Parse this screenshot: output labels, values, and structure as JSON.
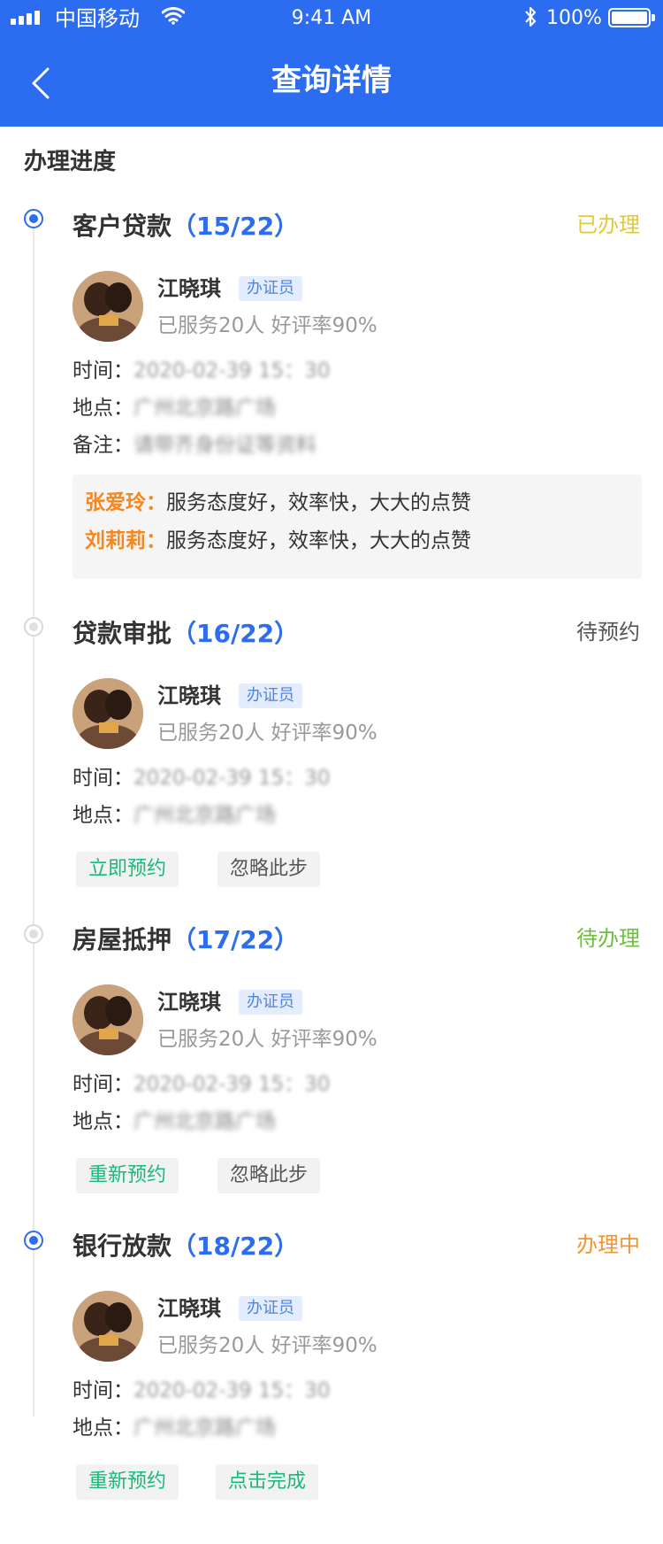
{
  "status_bar": {
    "carrier": "中国移动",
    "time": "9:41 AM",
    "battery": "100%"
  },
  "nav": {
    "title": "查询详情"
  },
  "section_title": "办理进度",
  "colors": {
    "primary": "#2b6cf0",
    "status_done": "#e2c93a",
    "status_pending": "#555555",
    "status_todo": "#6cbf3c",
    "status_in_progress": "#f5932f",
    "button_green": "#19b97b",
    "comment_name": "#f5871f"
  },
  "steps": [
    {
      "title": "客户贷款",
      "progress": "（15/22）",
      "status": "已办理",
      "agent": {
        "name": "江晓琪",
        "role": "办证员",
        "stats": "已服务20人   好评率90%"
      },
      "time_label": "时间：",
      "time_value": "2020-02-39 15：30",
      "location_label": "地点：",
      "location_value": "广州北京路广场",
      "note_label": "备注：",
      "note_value": "请带齐身份证等资料",
      "comments": [
        {
          "name": "张爱玲：",
          "text": "服务态度好，效率快，大大的点赞"
        },
        {
          "name": "刘莉莉：",
          "text": "服务态度好，效率快，大大的点赞"
        }
      ]
    },
    {
      "title": "贷款审批",
      "progress": "（16/22）",
      "status": "待预约",
      "agent": {
        "name": "江晓琪",
        "role": "办证员",
        "stats": "已服务20人   好评率90%"
      },
      "time_label": "时间：",
      "time_value": "2020-02-39 15：30",
      "location_label": "地点：",
      "location_value": "广州北京路广场",
      "buttons": [
        "立即预约",
        "忽略此步"
      ]
    },
    {
      "title": "房屋抵押",
      "progress": "（17/22）",
      "status": "待办理",
      "agent": {
        "name": "江晓琪",
        "role": "办证员",
        "stats": "已服务20人   好评率90%"
      },
      "time_label": "时间：",
      "time_value": "2020-02-39 15：30",
      "location_label": "地点：",
      "location_value": "广州北京路广场",
      "buttons": [
        "重新预约",
        "忽略此步"
      ]
    },
    {
      "title": "银行放款",
      "progress": "（18/22）",
      "status": "办理中",
      "agent": {
        "name": "江晓琪",
        "role": "办证员",
        "stats": "已服务20人   好评率90%"
      },
      "time_label": "时间：",
      "time_value": "2020-02-39 15：30",
      "location_label": "地点：",
      "location_value": "广州北京路广场",
      "buttons": [
        "重新预约",
        "点击完成"
      ]
    }
  ]
}
